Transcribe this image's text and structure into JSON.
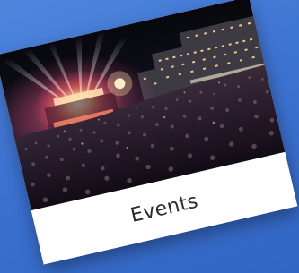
{
  "tile": {
    "caption": "Events",
    "image_subject": "night-concert-crowd-photo"
  },
  "colors": {
    "background": "#3f74d3",
    "card": "#ffffff",
    "caption_text": "#2b2b2b"
  }
}
